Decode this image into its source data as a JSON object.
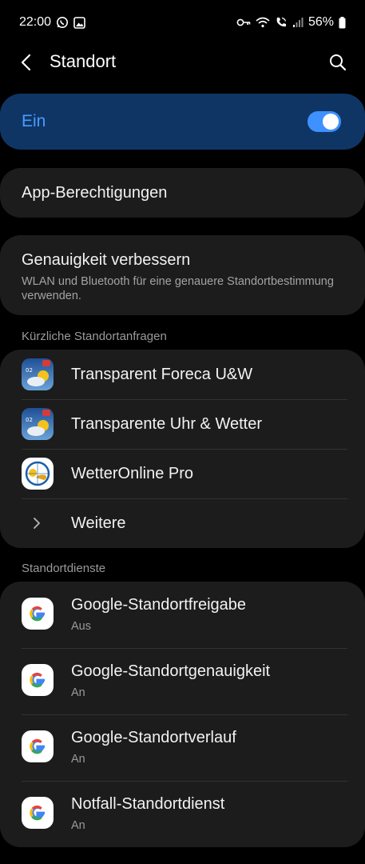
{
  "status_bar": {
    "time": "22:00",
    "battery": "56%",
    "left_icons": [
      "whatsapp-icon",
      "image-icon"
    ],
    "right_icons": [
      "key-icon",
      "wifi-icon",
      "wifi-call-icon",
      "signal-icon",
      "battery-icon"
    ]
  },
  "app_bar": {
    "title": "Standort",
    "back_icon": "back-arrow-icon",
    "search_icon": "search-icon"
  },
  "master_switch": {
    "label": "Ein",
    "state": true,
    "accent_color": "#3e91ff"
  },
  "permissions": {
    "label": "App-Berechtigungen"
  },
  "accuracy": {
    "title": "Genauigkeit verbessern",
    "subtitle": "WLAN und Bluetooth für eine genauere Standortbestimmung verwenden."
  },
  "recent_requests": {
    "header": "Kürzliche Standortanfragen",
    "items": [
      {
        "label": "Transparent Foreca U&W",
        "icon": "weather-widget-icon"
      },
      {
        "label": "Transparente Uhr & Wetter",
        "icon": "weather-widget-icon"
      },
      {
        "label": "WetterOnline Pro",
        "icon": "wetteronline-icon"
      }
    ],
    "more_label": "Weitere"
  },
  "location_services": {
    "header": "Standortdienste",
    "items": [
      {
        "title": "Google-Standortfreigabe",
        "status": "Aus",
        "icon": "google-icon"
      },
      {
        "title": "Google-Standortgenauigkeit",
        "status": "An",
        "icon": "google-icon"
      },
      {
        "title": "Google-Standortverlauf",
        "status": "An",
        "icon": "google-icon"
      },
      {
        "title": "Notfall-Standortdienst",
        "status": "An",
        "icon": "google-icon"
      }
    ]
  }
}
